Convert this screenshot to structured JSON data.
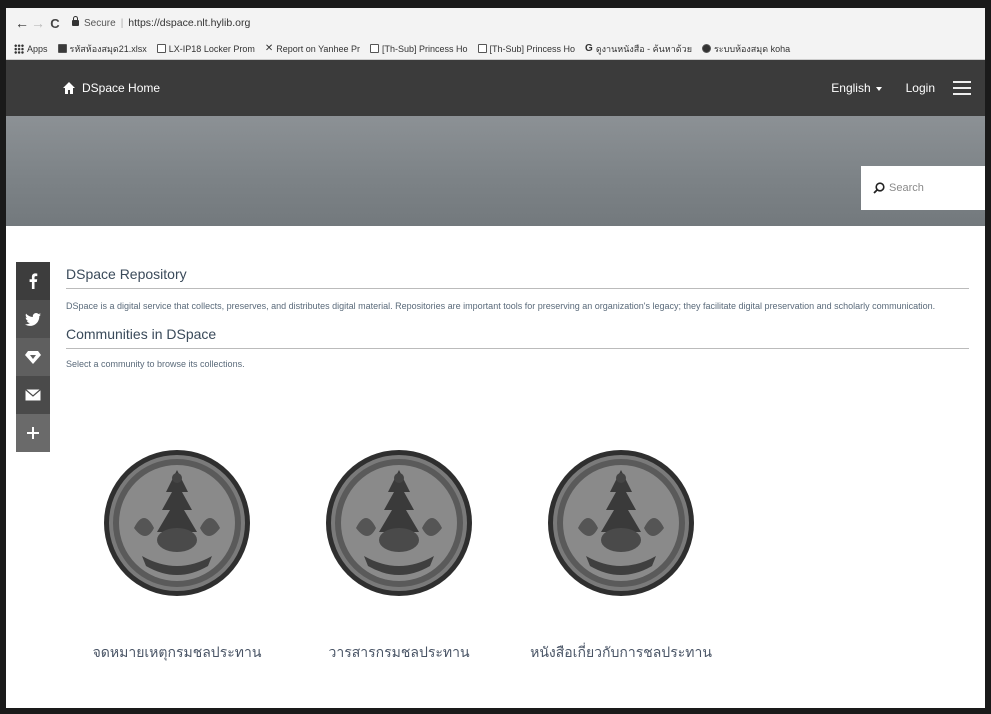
{
  "browser": {
    "secure_label": "Secure",
    "url": "https://dspace.nlt.hylib.org",
    "bookmarks": [
      {
        "icon": "grid-icon",
        "label": "Apps"
      },
      {
        "icon": "sheet-icon",
        "label": "รหัสห้องสมุด21.xlsx"
      },
      {
        "icon": "doc-icon",
        "label": "LX-IP18 Locker Prom"
      },
      {
        "icon": "x-icon",
        "label": "Report on Yanhee Pr"
      },
      {
        "icon": "doc-icon",
        "label": "[Th-Sub] Princess Ho"
      },
      {
        "icon": "doc-icon",
        "label": "[Th-Sub] Princess Ho"
      },
      {
        "icon": "google-icon",
        "label": "ดูงานหนังสือ - ค้นหาด้วย"
      },
      {
        "icon": "globe-icon",
        "label": "ระบบห้องสมุด koha"
      }
    ]
  },
  "navbar": {
    "home_label": "DSpace Home",
    "language": "English",
    "login": "Login"
  },
  "search": {
    "placeholder": "Search"
  },
  "share": [
    "facebook-icon",
    "twitter-icon",
    "google-plus-icon",
    "email-icon",
    "plus-icon"
  ],
  "main": {
    "repo_title": "DSpace Repository",
    "repo_intro": "DSpace is a digital service that collects, preserves, and distributes digital material. Repositories are important tools for preserving an organization's legacy; they facilitate digital preservation and scholarly communication.",
    "communities_title": "Communities in DSpace",
    "communities_hint": "Select a community to browse its collections.",
    "communities": [
      {
        "label": "จดหมายเหตุกรมชลประทาน"
      },
      {
        "label": "วารสารกรมชลประทาน"
      },
      {
        "label": "หนังสือเกี่ยวกับการชลประทาน"
      }
    ]
  },
  "colors": {
    "navbar": "#3b3b3b",
    "banner": "#7d8387",
    "heading": "#3a4a5a"
  }
}
